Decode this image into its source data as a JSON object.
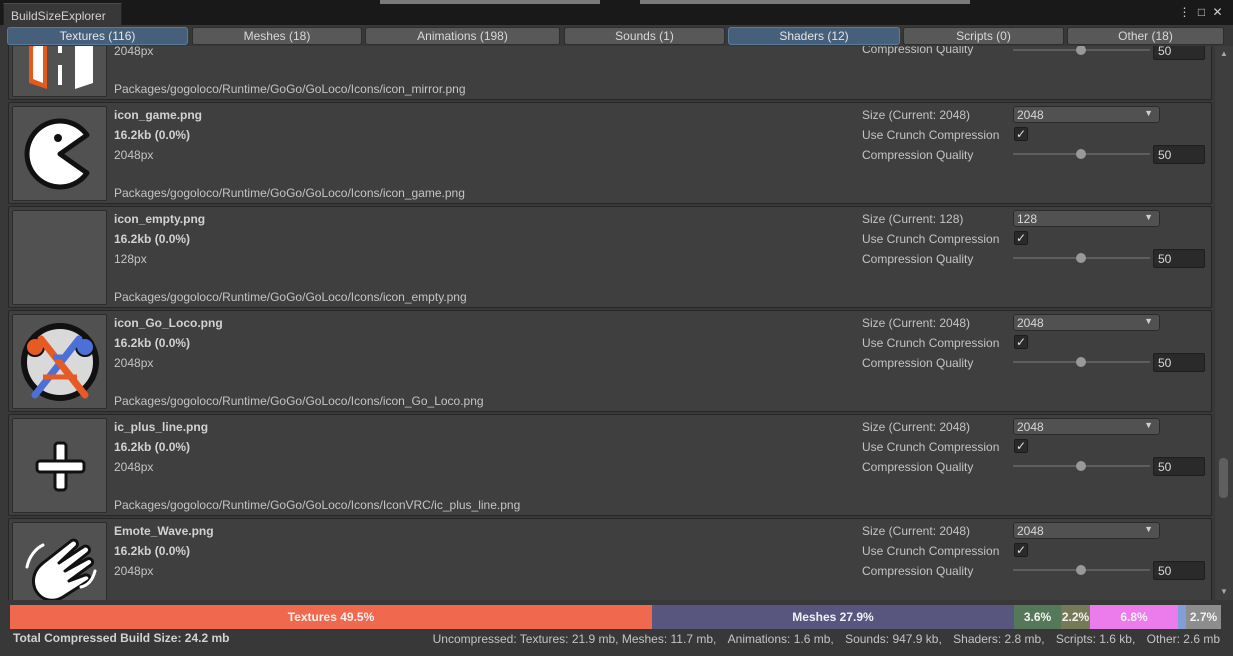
{
  "window": {
    "title": "BuildSizeExplorer",
    "menu_icon": "⋮",
    "maximize_icon": "□",
    "close_icon": "✕"
  },
  "tabs": [
    {
      "label": "Textures (116)",
      "active": true
    },
    {
      "label": "Meshes (18)",
      "active": false
    },
    {
      "label": "Animations (198)",
      "active": false
    },
    {
      "label": "Sounds (1)",
      "active": false
    },
    {
      "label": "Shaders (12)",
      "active": true
    },
    {
      "label": "Scripts (0)",
      "active": false
    },
    {
      "label": "Other (18)",
      "active": false
    }
  ],
  "labels": {
    "crunch": "Use Crunch Compression",
    "quality": "Compression Quality",
    "check": "✓",
    "caret": "▼"
  },
  "partial_item": {
    "px": "2048px",
    "quality_label": "Compression Quality",
    "quality_value": "50",
    "path": "Packages/gogoloco/Runtime/GoGo/GoLoco/Icons/icon_mirror.png"
  },
  "items": [
    {
      "name": "icon_game.png",
      "size": "16.2kb (0.0%)",
      "px": "2048px",
      "path": "Packages/gogoloco/Runtime/GoGo/GoLoco/Icons/icon_game.png",
      "size_label": "Size (Current: 2048)",
      "size_value": "2048",
      "crunch": true,
      "quality": "50",
      "icon": "pacman-icon"
    },
    {
      "name": "icon_empty.png",
      "size": "16.2kb (0.0%)",
      "px": "128px",
      "path": "Packages/gogoloco/Runtime/GoGo/GoLoco/Icons/icon_empty.png",
      "size_label": "Size (Current: 128)",
      "size_value": "128",
      "crunch": true,
      "quality": "50",
      "icon": "empty-icon"
    },
    {
      "name": "icon_Go_Loco.png",
      "size": "16.2kb (0.0%)",
      "px": "2048px",
      "path": "Packages/gogoloco/Runtime/GoGo/GoLoco/Icons/icon_Go_Loco.png",
      "size_label": "Size (Current: 2048)",
      "size_value": "2048",
      "crunch": true,
      "quality": "50",
      "icon": "goloco-logo-icon"
    },
    {
      "name": "ic_plus_line.png",
      "size": "16.2kb (0.0%)",
      "px": "2048px",
      "path": "Packages/gogoloco/Runtime/GoGo/GoLoco/Icons/IconVRC/ic_plus_line.png",
      "size_label": "Size (Current: 2048)",
      "size_value": "2048",
      "crunch": true,
      "quality": "50",
      "icon": "plus-icon"
    },
    {
      "name": "Emote_Wave.png",
      "size": "16.2kb (0.0%)",
      "px": "2048px",
      "path": "",
      "size_label": "Size (Current: 2048)",
      "size_value": "2048",
      "crunch": true,
      "quality": "50",
      "icon": "wave-hand-icon"
    }
  ],
  "size_bar": [
    {
      "label": "Textures 49.5%",
      "percent": 49.5,
      "color": "#f0694f"
    },
    {
      "label": "Meshes 27.9%",
      "percent": 27.9,
      "color": "#58557f"
    },
    {
      "label": "3.6%",
      "percent": 3.6,
      "color": "#55775a"
    },
    {
      "label": "2.2%",
      "percent": 2.2,
      "color": "#777a59"
    },
    {
      "label": "6.8%",
      "percent": 6.8,
      "color": "#ec7bec"
    },
    {
      "label": "",
      "percent": 0.6,
      "color": "#7f9fd6"
    },
    {
      "label": "2.7%",
      "percent": 2.7,
      "color": "#8d8d8d"
    }
  ],
  "footer": {
    "total": "Total Compressed Build Size: 24.2 mb",
    "uncompressed": [
      "Uncompressed: Textures: 21.9 mb, Meshes: 11.7 mb,",
      "Animations: 1.6 mb,",
      "Sounds: 947.9 kb,",
      "Shaders: 2.8 mb,",
      "Scripts: 1.6 kb,",
      "Other: 2.6 mb"
    ]
  }
}
